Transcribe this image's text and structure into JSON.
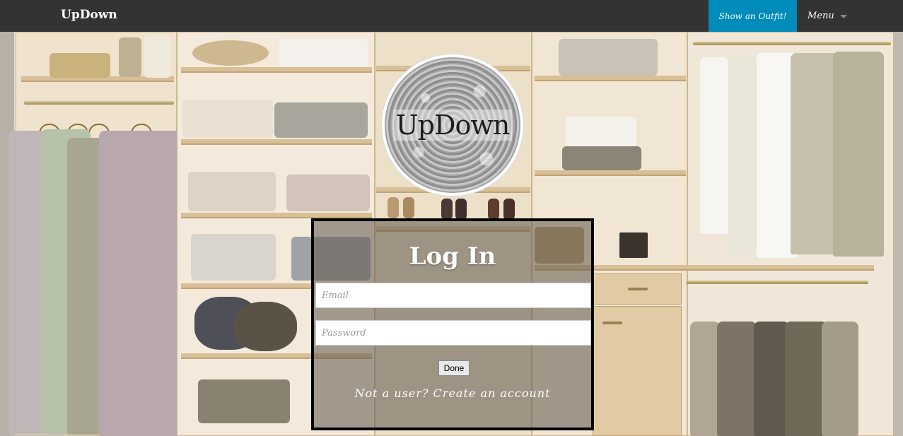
{
  "navbar": {
    "brand": "UpDown",
    "cta_label": "Show an Outfit!",
    "menu_label": "Menu",
    "colors": {
      "bar": "#333333",
      "cta": "#008cba"
    }
  },
  "hero": {
    "logo_text": "UpDown"
  },
  "login": {
    "title": "Log In",
    "email_placeholder": "Email",
    "password_placeholder": "Password",
    "done_label": "Done",
    "signup_text": "Not a user? Create an account"
  }
}
